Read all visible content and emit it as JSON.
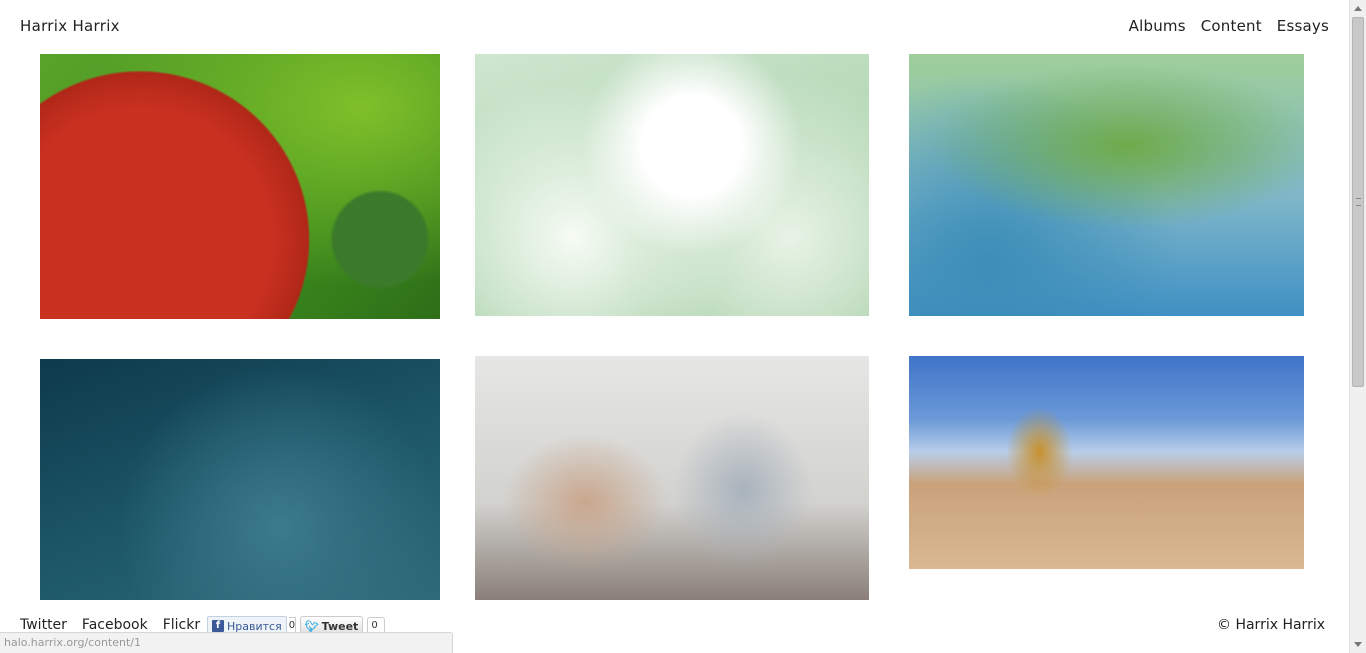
{
  "header": {
    "site_title": "Harrix Harrix",
    "nav": [
      "Albums",
      "Content",
      "Essays"
    ]
  },
  "gallery": {
    "tiles": [
      {
        "subject": "strawberry macro"
      },
      {
        "subject": "white flower macro"
      },
      {
        "subject": "green foliage on blue"
      },
      {
        "subject": "blue bokeh"
      },
      {
        "subject": "couple portrait"
      },
      {
        "subject": "church fisheye panorama"
      }
    ]
  },
  "footer": {
    "links": [
      "Twitter",
      "Facebook",
      "Flickr"
    ],
    "vk_like_label": "Нравится",
    "vk_like_count": "0",
    "tweet_label": "Tweet",
    "tweet_count": "0",
    "copyright": "© Harrix Harrix"
  },
  "status_bar": {
    "url": "halo.harrix.org/content/1"
  }
}
